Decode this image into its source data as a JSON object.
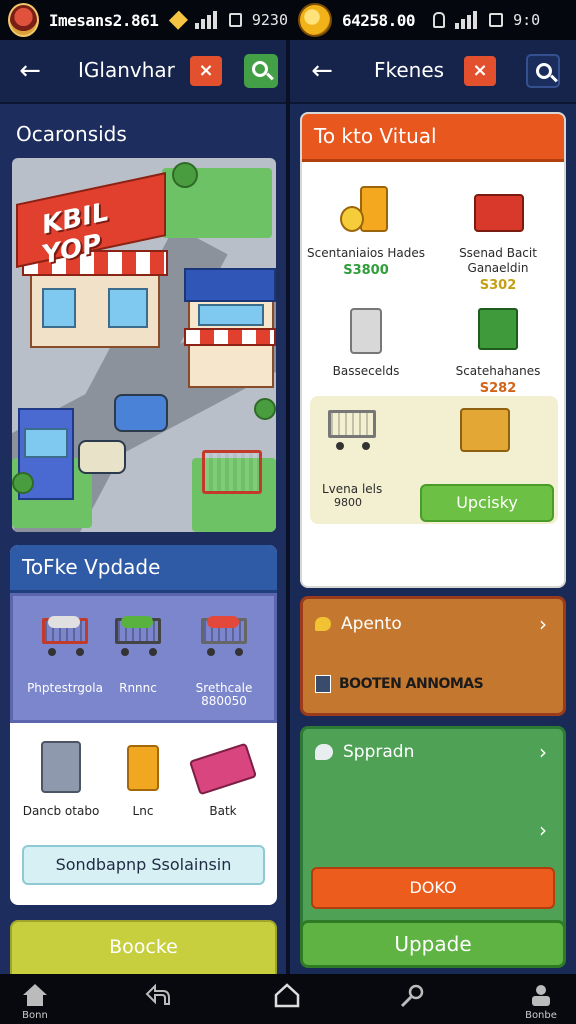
{
  "status_left": {
    "carrier": "Imesans2.861",
    "time": "9230"
  },
  "status_right": {
    "balance": "64258.00",
    "time": "9:0"
  },
  "left": {
    "topbar": {
      "title": "IGlanvhar",
      "back_icon": "arrow-left-icon",
      "close_icon": "close-icon",
      "search_icon": "search-icon"
    },
    "section_title": "Ocaronsids",
    "illustration": {
      "shop_sign": "KBIL YOP"
    },
    "update_card": {
      "title": "ToFke Vpdade",
      "row1": [
        {
          "label": "Phptestrgola",
          "sub": ""
        },
        {
          "label": "Rnnnc",
          "sub": ""
        },
        {
          "label": "Srethcale",
          "sub": "880050"
        }
      ],
      "row2": [
        {
          "label": "Dancb otabo"
        },
        {
          "label": "Lnc"
        },
        {
          "label": "Batk"
        }
      ],
      "button": "Sondbapnp Ssolainsin"
    },
    "bottom_card": {
      "title": "Boocke"
    }
  },
  "right": {
    "topbar": {
      "title": "Fkenes",
      "back_icon": "arrow-left-icon",
      "close_icon": "close-icon",
      "search_icon": "search-icon"
    },
    "virtual_card": {
      "title": "To kto Vitual",
      "items": [
        {
          "name": "Scentaniaios Hades",
          "price": "S3800",
          "price_color": "green",
          "icon": "coins-jar-icon"
        },
        {
          "name": "Ssenad Bacit Ganaeldin",
          "price": "S302",
          "price_color": "gold",
          "icon": "red-chest-icon"
        },
        {
          "name": "Bassecelds",
          "price": "",
          "icon": "trash-can-icon"
        },
        {
          "name": "Scatehahanes",
          "price": "S282",
          "price_color": "orange",
          "icon": "green-box-icon"
        }
      ],
      "highlight": {
        "name": "Lvena lels",
        "price": "9800"
      },
      "button": "Upcisky"
    },
    "appeal_card": {
      "title": "Apento",
      "sub": "BOOTEN ANNOMAS"
    },
    "upgrade_card": {
      "title": "Sppradn",
      "button": "DOKO"
    },
    "upgrade_button": "Uppade"
  },
  "nav": [
    {
      "label": "Bonn",
      "icon": "home-icon"
    },
    {
      "label": "",
      "icon": "back-icon"
    },
    {
      "label": "",
      "icon": "house-outline-icon"
    },
    {
      "label": "",
      "icon": "search-key-icon"
    },
    {
      "label": "Bonbe",
      "icon": "profile-icon"
    }
  ],
  "colors": {
    "accent_orange": "#e8571e",
    "accent_green": "#5fb343",
    "panel_blue": "#1c2d5e"
  }
}
